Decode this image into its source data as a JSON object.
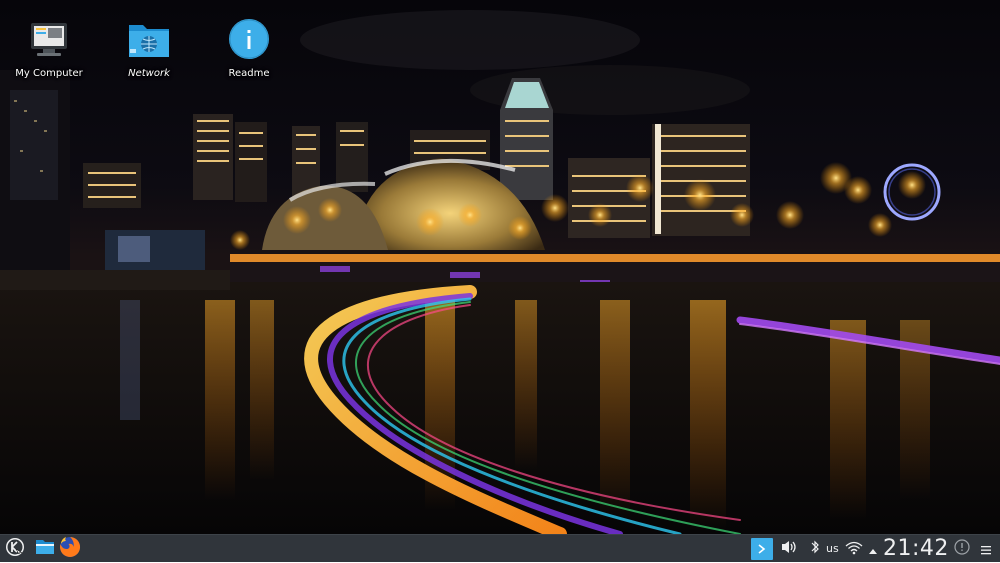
{
  "desktop": {
    "icons": [
      {
        "label": "My Computer",
        "icon": "computer-icon"
      },
      {
        "label": "Network",
        "icon": "network-folder-icon"
      },
      {
        "label": "Readme",
        "icon": "info-icon"
      }
    ],
    "wallpaper": "night-city-skyline-light-trails"
  },
  "taskbar": {
    "launchers": [
      {
        "name": "application-launcher",
        "icon": "kde-logo-icon"
      },
      {
        "name": "file-manager",
        "icon": "folder-icon"
      },
      {
        "name": "firefox",
        "icon": "firefox-icon"
      }
    ],
    "tray": {
      "icons": [
        "show-hidden-icon",
        "volume-icon",
        "bluetooth-icon",
        "wifi-icon",
        "expand-arrow-icon"
      ],
      "keyboard_layout": "us"
    },
    "clock": "21:42",
    "colors": {
      "panel": "#30353b",
      "accent": "#3daee9",
      "text": "#eff0f1"
    }
  }
}
